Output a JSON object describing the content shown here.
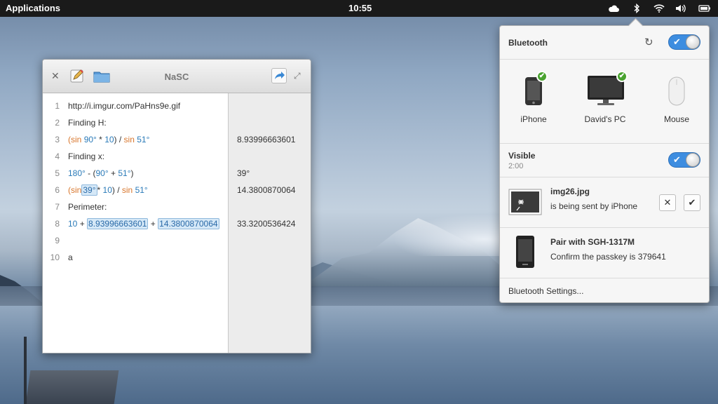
{
  "panel": {
    "applications": "Applications",
    "clock": "10:55",
    "indicators": [
      "cloud-icon",
      "bluetooth-icon",
      "wifi-icon",
      "volume-icon",
      "battery-icon"
    ]
  },
  "nasc": {
    "title": "NaSC",
    "lines": [
      {
        "num": "1",
        "text": "http://i.imgur.com/PaHns9e.gif",
        "result": ""
      },
      {
        "num": "2",
        "text": "Finding H:",
        "result": ""
      },
      {
        "num": "3",
        "text": "(sin 90° * 10) / sin 51°",
        "result": "8.93996663601"
      },
      {
        "num": "4",
        "text": "Finding x:",
        "result": ""
      },
      {
        "num": "5",
        "text": "180° - (90° + 51°)",
        "result": "39°"
      },
      {
        "num": "6",
        "text": "(sin 39° * 10) / sin 51°",
        "result": "14.3800870064"
      },
      {
        "num": "7",
        "text": "Perimeter:",
        "result": ""
      },
      {
        "num": "8",
        "text": "10 + 8.93996663601 + 14.3800870064",
        "result": "33.3200536424"
      },
      {
        "num": "9",
        "text": "",
        "result": ""
      },
      {
        "num": "10",
        "text": "a",
        "result": ""
      }
    ]
  },
  "bluetooth": {
    "header": "Bluetooth",
    "devices": [
      {
        "name": "iPhone",
        "connected": true
      },
      {
        "name": "David's PC",
        "connected": true
      },
      {
        "name": "Mouse",
        "connected": false
      }
    ],
    "visible_label": "Visible",
    "visible_time": "2:00",
    "transfer": {
      "file": "img26.jpg",
      "status": "is being sent by iPhone"
    },
    "pair": {
      "title": "Pair with SGH-1317M",
      "message": "Confirm the passkey is 379641"
    },
    "settings_link": "Bluetooth Settings...",
    "accent": "#3d8de0",
    "connected_color": "#4aa330"
  }
}
